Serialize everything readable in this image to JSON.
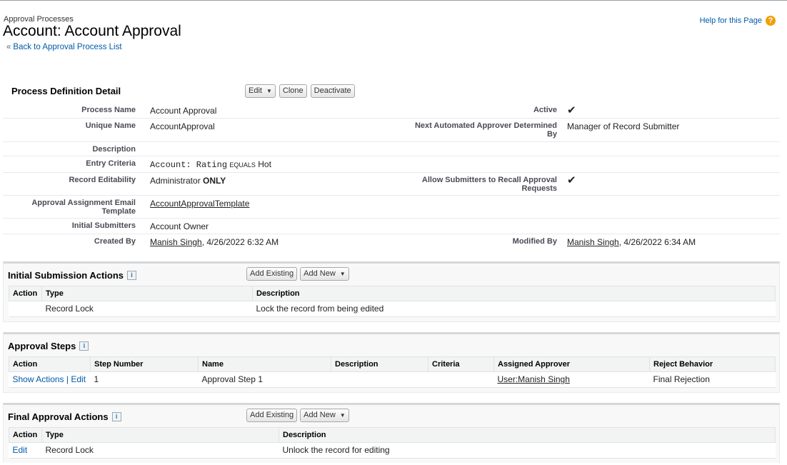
{
  "header": {
    "breadcrumb": "Approval Processes",
    "title": "Account: Account Approval",
    "back_link": "Back to Approval Process List",
    "help": "Help for this Page"
  },
  "detail": {
    "title": "Process Definition Detail",
    "buttons": {
      "edit": "Edit",
      "clone": "Clone",
      "deactivate": "Deactivate"
    },
    "process_name_label": "Process Name",
    "process_name": "Account Approval",
    "active_label": "Active",
    "active": true,
    "unique_name_label": "Unique Name",
    "unique_name": "AccountApproval",
    "next_approver_label": "Next Automated Approver Determined By",
    "next_approver": "Manager of Record Submitter",
    "description_label": "Description",
    "description": "",
    "entry_criteria_label": "Entry Criteria",
    "entry_criteria": {
      "field": "Account: Rating",
      "operator": "EQUALS",
      "value": "Hot"
    },
    "record_editability_label": "Record Editability",
    "record_editability": "Administrator",
    "record_editability_strong": "ONLY",
    "allow_recall_label": "Allow Submitters to Recall Approval Requests",
    "allow_recall": true,
    "email_template_label": "Approval Assignment Email Template",
    "email_template": "AccountApprovalTemplate",
    "initial_submitters_label": "Initial Submitters",
    "initial_submitters": "Account Owner",
    "created_by_label": "Created By",
    "created_by_user": "Manish Singh",
    "created_by_date": ", 4/26/2022 6:32 AM",
    "modified_by_label": "Modified By",
    "modified_by_user": "Manish Singh",
    "modified_by_date": ", 4/26/2022 6:34 AM"
  },
  "initial_submission": {
    "title": "Initial Submission Actions",
    "add_existing": "Add Existing",
    "add_new": "Add New",
    "columns": [
      "Action",
      "Type",
      "Description"
    ],
    "rows": [
      {
        "action": "",
        "type": "Record Lock",
        "description": "Lock the record from being edited"
      }
    ]
  },
  "approval_steps": {
    "title": "Approval Steps",
    "columns": [
      "Action",
      "Step Number",
      "Name",
      "Description",
      "Criteria",
      "Assigned Approver",
      "Reject Behavior"
    ],
    "rows": [
      {
        "show_actions": "Show Actions",
        "sep": "|",
        "edit": "Edit",
        "step_number": "1",
        "name": "Approval Step 1",
        "description": "",
        "criteria": "",
        "assigned_approver": "User:Manish Singh",
        "reject_behavior": "Final Rejection"
      }
    ]
  },
  "final_approval": {
    "title": "Final Approval Actions",
    "add_existing": "Add Existing",
    "add_new": "Add New",
    "columns": [
      "Action",
      "Type",
      "Description"
    ],
    "rows": [
      {
        "action": "Edit",
        "type": "Record Lock",
        "description": "Unlock the record for editing"
      }
    ]
  },
  "icons": {
    "help": "question-icon",
    "info": "info-icon",
    "check": "checkmark-icon",
    "caret": "caret-down-icon"
  },
  "colors": {
    "link": "#015ba7",
    "help_icon": "#f29f06",
    "section_border": "#d5d8db"
  }
}
